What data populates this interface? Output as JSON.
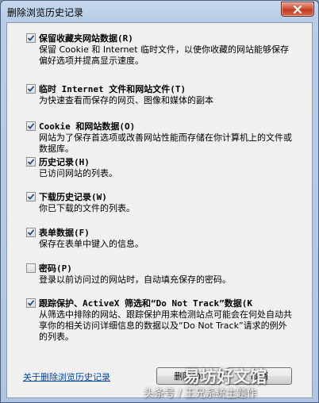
{
  "window": {
    "title": "删除浏览历史记录"
  },
  "options": [
    {
      "title": "保留收藏夹网站数据(R)",
      "desc": "保留 Cookie 和 Internet 临时文件，以使你收藏的网站能够保存偏好选项并提高显示速度。",
      "checked": true
    },
    {
      "title": "临时 Internet 文件和网站文件(T)",
      "desc": "为快速查看而保存的网页、图像和媒体的副本",
      "checked": true
    },
    {
      "title": "Cookie 和网站数据(O)",
      "desc": "网站为了保存首选项或改善网站性能而存储在你计算机上的文件或数据库。",
      "checked": true
    },
    {
      "title": "历史记录(H)",
      "desc": "已访问网站的列表。",
      "checked": true
    },
    {
      "title": "下载历史记录(W)",
      "desc": "你已下载的文件的列表。",
      "checked": true
    },
    {
      "title": "表单数据(F)",
      "desc": "保存在表单中键入的信息。",
      "checked": true
    },
    {
      "title": "密码(P)",
      "desc": "登录以前访问过的网站时，自动填充保存的密码。",
      "checked": false
    },
    {
      "title": "跟踪保护、ActiveX 筛选和“Do Not Track”数据(K",
      "desc": "从筛选中排除的网站、跟踪保护用来检测站点可能会在何处自动共享你的相关访问详细信息的数据以及“Do Not Track”请求的例外的列表。",
      "checked": true
    }
  ],
  "footer": {
    "help_link": "关于删除浏览历史记录",
    "delete_label": "删除(D)",
    "cancel_label": "取消"
  },
  "watermark": {
    "main": "易坊好文馆",
    "sub": "头条号 / 王兄系统主题作"
  },
  "colors": {
    "check": "#2d4b7a",
    "link": "#0645ad",
    "close": "#c33b1f"
  }
}
